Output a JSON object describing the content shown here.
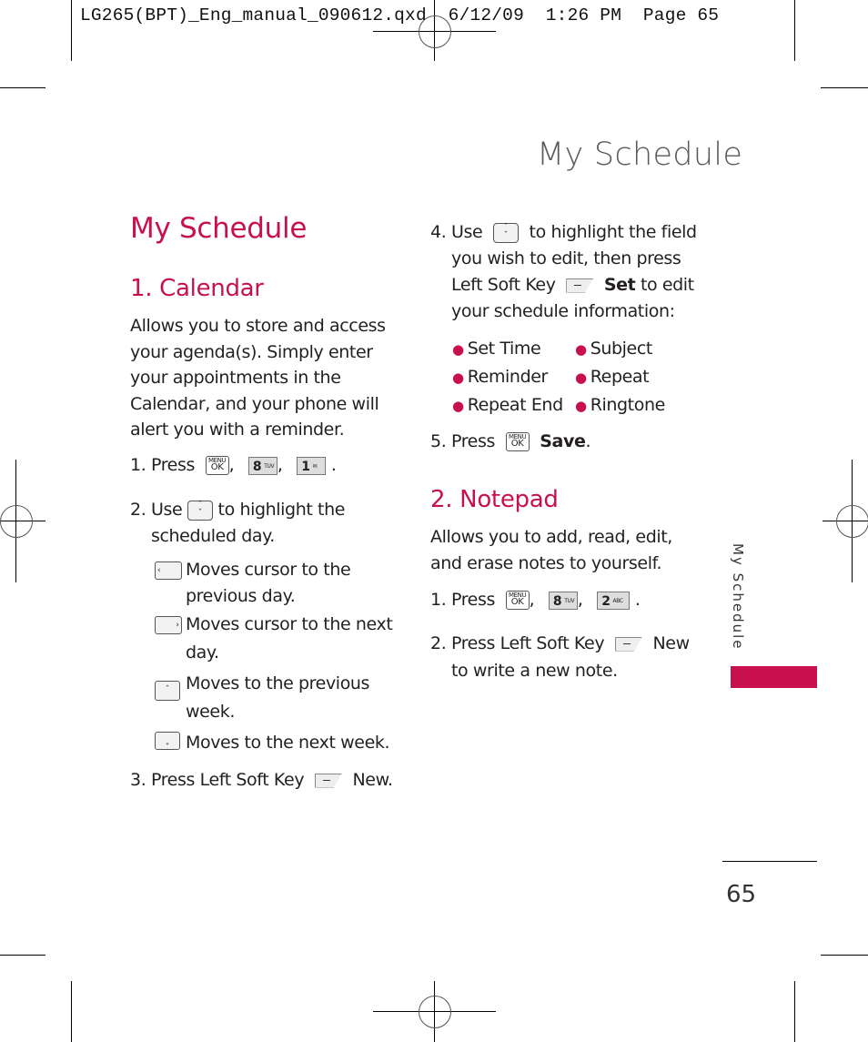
{
  "slug": {
    "text": "LG265(BPT)_Eng_manual_090612.qxd  6/12/09  1:26 PM  Page 65"
  },
  "colors": {
    "accent": "#c8104f",
    "text": "#231f20",
    "title_gray": "#5a5a5a"
  },
  "header": {
    "title": "My Schedule"
  },
  "main": {
    "heading": "My Schedule",
    "calendar": {
      "heading": "1. Calendar",
      "intro": [
        "Allows you to store and access",
        "your agenda(s). Simply enter",
        "your appointments in the",
        "Calendar, and your phone will",
        "alert you with a reminder."
      ],
      "step1": {
        "prefix": "1. Press",
        "keys": [
          {
            "icon": "menu-ok-key",
            "top": "MENU",
            "main": "OK"
          },
          {
            "icon": "key-8",
            "digit": "8",
            "letters": "TUV"
          },
          {
            "icon": "key-1",
            "digit": "1",
            "letters": "✉"
          }
        ],
        "sep": ",",
        "end": "."
      },
      "step2": {
        "prefix": "2. Use",
        "suffix": "to highlight the",
        "line2": "scheduled day."
      },
      "nav": [
        {
          "icon": "nav-left-key",
          "glyph": "‹",
          "lines": [
            "Moves cursor to the",
            "previous day."
          ]
        },
        {
          "icon": "nav-right-key",
          "glyph": "›",
          "lines": [
            "Moves cursor to the next",
            "day."
          ]
        },
        {
          "icon": "nav-up-key",
          "glyph": "ˆ",
          "lines": [
            "Moves to the previous",
            "week."
          ]
        },
        {
          "icon": "nav-down-key",
          "glyph": "ˬ",
          "lines": [
            "Moves to the next week."
          ]
        }
      ],
      "step3": {
        "prefix": "3. Press Left Soft Key",
        "action": "New",
        "end": "."
      },
      "step4": {
        "prefix": "4. Use",
        "suffix": "to highlight the field",
        "line2": "you wish to edit, then press",
        "line3_prefix": "Left Soft Key",
        "line3_action": "Set",
        "line3_suffix": "to edit",
        "line4": "your schedule information:"
      },
      "fields": [
        "Set Time",
        "Subject",
        "Reminder",
        "Repeat",
        "Repeat End",
        "Ringtone"
      ],
      "step5": {
        "prefix": "5. Press",
        "action": "Save",
        "end": "."
      }
    },
    "notepad": {
      "heading": "2. Notepad",
      "intro": [
        "Allows you to add, read, edit,",
        "and erase notes to yourself."
      ],
      "step1": {
        "prefix": "1. Press",
        "keys": [
          {
            "icon": "menu-ok-key",
            "top": "MENU",
            "main": "OK"
          },
          {
            "icon": "key-8",
            "digit": "8",
            "letters": "TUV"
          },
          {
            "icon": "key-2",
            "digit": "2",
            "letters": "ABC"
          }
        ],
        "sep": ",",
        "end": "."
      },
      "step2": {
        "prefix": "2. Press Left Soft Key",
        "action": "New",
        "line2": "to write a new note."
      }
    }
  },
  "sidebar": {
    "label": "My Schedule"
  },
  "footer": {
    "page_number": "65"
  }
}
